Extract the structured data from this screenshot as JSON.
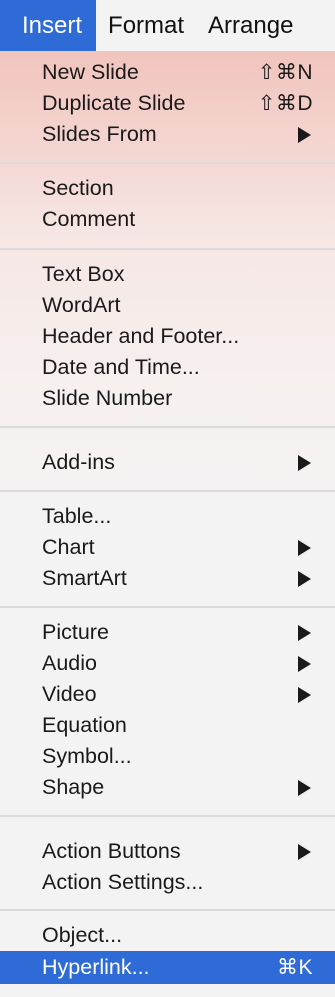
{
  "menubar": {
    "items": [
      {
        "label": "Insert"
      },
      {
        "label": "Format"
      },
      {
        "label": "Arrange"
      }
    ]
  },
  "colors": {
    "selection": "#2e6bd6",
    "menu_background": "#f4f3f3",
    "separator": "#dcdada"
  },
  "menu": {
    "new_slide": {
      "label": "New Slide",
      "shortcut": "⇧⌘N"
    },
    "duplicate_slide": {
      "label": "Duplicate Slide",
      "shortcut": "⇧⌘D"
    },
    "slides_from": {
      "label": "Slides From"
    },
    "section": {
      "label": "Section"
    },
    "comment": {
      "label": "Comment"
    },
    "text_box": {
      "label": "Text Box"
    },
    "wordart": {
      "label": "WordArt"
    },
    "header_footer": {
      "label": "Header and Footer..."
    },
    "date_time": {
      "label": "Date and Time..."
    },
    "slide_number": {
      "label": "Slide Number"
    },
    "add_ins": {
      "label": "Add-ins"
    },
    "table": {
      "label": "Table..."
    },
    "chart": {
      "label": "Chart"
    },
    "smartart": {
      "label": "SmartArt"
    },
    "picture": {
      "label": "Picture"
    },
    "audio": {
      "label": "Audio"
    },
    "video": {
      "label": "Video"
    },
    "equation": {
      "label": "Equation"
    },
    "symbol": {
      "label": "Symbol..."
    },
    "shape": {
      "label": "Shape"
    },
    "action_buttons": {
      "label": "Action Buttons"
    },
    "action_settings": {
      "label": "Action Settings..."
    },
    "object": {
      "label": "Object..."
    },
    "hyperlink": {
      "label": "Hyperlink...",
      "shortcut": "⌘K"
    }
  }
}
